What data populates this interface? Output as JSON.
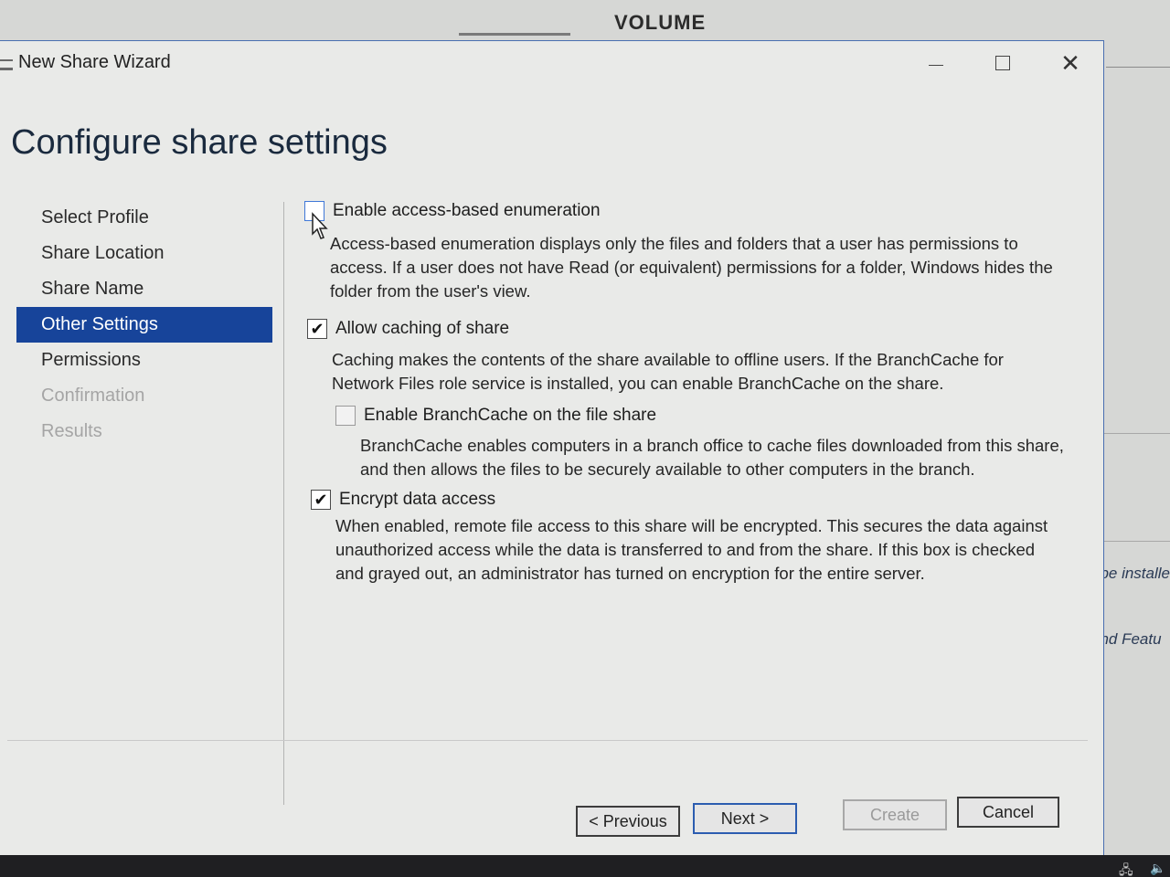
{
  "background": {
    "title": "VOLUME",
    "right_text_1": "t be installe",
    "right_text_2": "and Featu"
  },
  "window": {
    "title": "New Share Wizard",
    "minimize_icon": "minimize-icon",
    "maximize_icon": "maximize-icon",
    "close_icon": "close-icon"
  },
  "page_title": "Configure share settings",
  "nav": {
    "items": [
      {
        "label": "Select Profile",
        "state": "normal"
      },
      {
        "label": "Share Location",
        "state": "normal"
      },
      {
        "label": "Share Name",
        "state": "normal"
      },
      {
        "label": "Other Settings",
        "state": "active"
      },
      {
        "label": "Permissions",
        "state": "normal"
      },
      {
        "label": "Confirmation",
        "state": "disabled"
      },
      {
        "label": "Results",
        "state": "disabled"
      }
    ],
    "active_color": "#17449a"
  },
  "options": {
    "abe": {
      "label": "Enable access-based enumeration",
      "checked": false,
      "description_lines": [
        "Access-based enumeration displays only the files and folders that a user has permissions to",
        "access. If a user does not have Read (or equivalent) permissions for a folder, Windows hides the",
        "folder from the user's view."
      ]
    },
    "caching": {
      "label": "Allow caching of share",
      "checked": true,
      "description_lines": [
        "Caching makes the contents of the share available to offline users. If the BranchCache for",
        "Network Files role service is installed, you can enable BranchCache on the share."
      ]
    },
    "branchcache": {
      "label": "Enable BranchCache on the file share",
      "checked": false,
      "disabled": true,
      "description_lines": [
        "BranchCache enables computers in a branch office to cache files downloaded from this share,",
        "and then allows the files to be securely available to other computers in the branch."
      ]
    },
    "encrypt": {
      "label": "Encrypt data access",
      "checked": true,
      "description_lines": [
        "When enabled, remote file access to this share will be encrypted. This secures the data against",
        "unauthorized access while the data is transferred to and from the share. If this box is checked",
        "and grayed out, an administrator has turned on encryption for the entire server."
      ]
    }
  },
  "buttons": {
    "previous": "< Previous",
    "next": "Next >",
    "create": "Create",
    "cancel": "Cancel"
  }
}
